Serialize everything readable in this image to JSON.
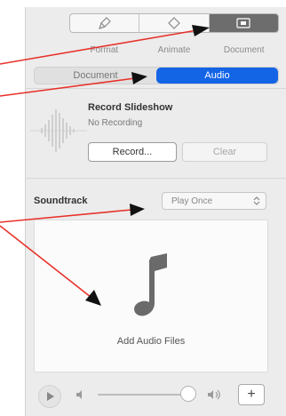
{
  "toolbar": {
    "tabs": [
      {
        "label": "Format",
        "icon": "paintbrush-icon"
      },
      {
        "label": "Animate",
        "icon": "animate-diamond-icon"
      },
      {
        "label": "Document",
        "icon": "document-icon"
      }
    ],
    "active_index": 2
  },
  "inspector_tabs": {
    "items": [
      {
        "label": "Document"
      },
      {
        "label": "Audio"
      }
    ],
    "active_index": 1
  },
  "record": {
    "title": "Record Slideshow",
    "status": "No Recording",
    "record_label": "Record...",
    "clear_label": "Clear"
  },
  "soundtrack": {
    "label": "Soundtrack",
    "mode": "Play Once",
    "drop_label": "Add Audio Files"
  },
  "bottom": {
    "add_label": "+"
  },
  "colors": {
    "accent": "#1464e6",
    "annotation_arrow": "#e8322a"
  }
}
